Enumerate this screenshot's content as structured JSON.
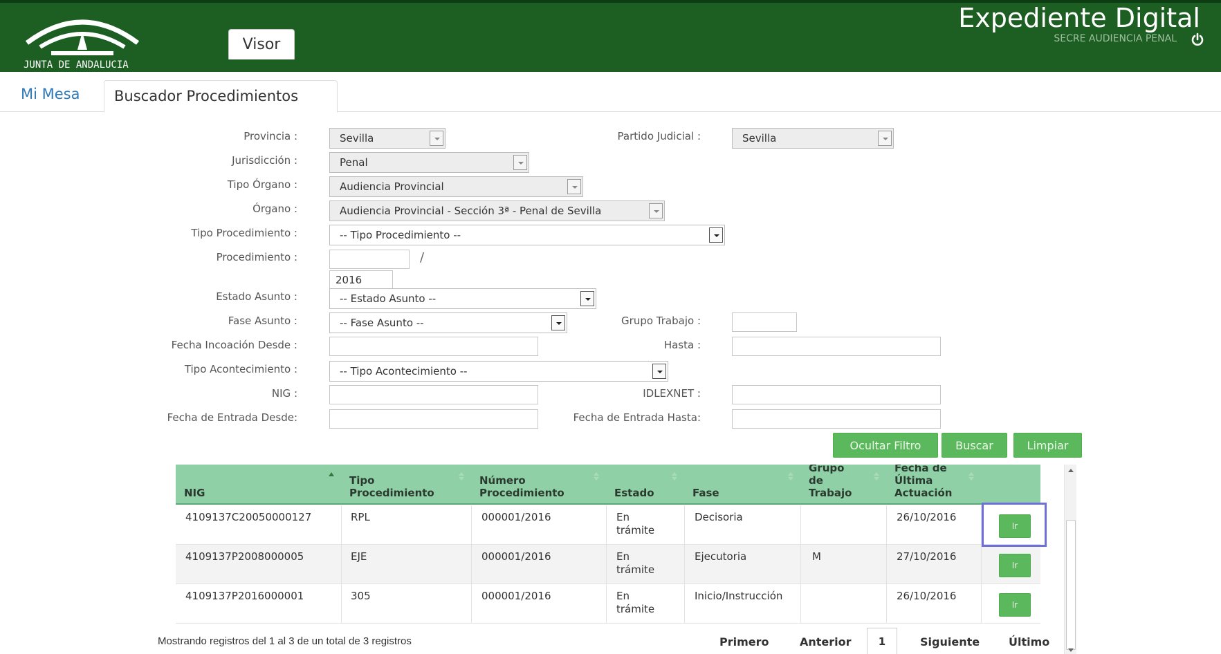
{
  "header": {
    "logo_text": "JUNTA DE ANDALUCIA",
    "visor_tab": "Visor",
    "app_title": "Expediente Digital",
    "user": "SECRE AUDIENCIA PENAL",
    "logout_icon": "power-icon"
  },
  "nav": {
    "mi_mesa": "Mi Mesa",
    "buscador": "Buscador Procedimientos"
  },
  "form": {
    "provincia": {
      "label": "Provincia :",
      "value": "Sevilla"
    },
    "partido_judicial": {
      "label": "Partido Judicial :",
      "value": "Sevilla"
    },
    "jurisdiccion": {
      "label": "Jurisdicción :",
      "value": "Penal"
    },
    "tipo_organo": {
      "label": "Tipo Órgano :",
      "value": "Audiencia Provincial"
    },
    "organo": {
      "label": "Órgano :",
      "value": "Audiencia Provincial - Sección 3ª - Penal de Sevilla"
    },
    "tipo_procedimiento": {
      "label": "Tipo Procedimiento :",
      "value": "-- Tipo Procedimiento --"
    },
    "procedimiento": {
      "label": "Procedimiento :",
      "number": "",
      "year": "2016",
      "separator": "/"
    },
    "estado_asunto": {
      "label": "Estado Asunto :",
      "value": "-- Estado Asunto --"
    },
    "fase_asunto": {
      "label": "Fase Asunto :",
      "value": "-- Fase Asunto --"
    },
    "grupo_trabajo": {
      "label": "Grupo Trabajo :",
      "value": ""
    },
    "fecha_incoacion_desde": {
      "label": "Fecha Incoación Desde :",
      "value": ""
    },
    "hasta": {
      "label": "Hasta :",
      "value": ""
    },
    "tipo_acontecimiento": {
      "label": "Tipo Acontecimiento :",
      "value": "-- Tipo Acontecimiento --"
    },
    "nig": {
      "label": "NIG :",
      "value": ""
    },
    "idlexnet": {
      "label": "IDLEXNET :",
      "value": ""
    },
    "fecha_entrada_desde": {
      "label": "Fecha de Entrada Desde:",
      "value": ""
    },
    "fecha_entrada_hasta": {
      "label": "Fecha de Entrada Hasta:",
      "value": ""
    }
  },
  "buttons": {
    "ocultar": "Ocultar Filtro",
    "buscar": "Buscar",
    "limpiar": "Limpiar",
    "color": "#5cb85c"
  },
  "table": {
    "columns": [
      {
        "line1": "",
        "line2": "NIG"
      },
      {
        "line1": "Tipo",
        "line2": "Procedimiento"
      },
      {
        "line1": "Número",
        "line2": "Procedimiento"
      },
      {
        "line1": "",
        "line2": "Estado"
      },
      {
        "line1": "",
        "line2": "Fase"
      },
      {
        "line1": "Grupo",
        "line2": "de",
        "line3": "Trabajo"
      },
      {
        "line1": "Fecha de",
        "line2": "Última",
        "line3": "Actuación"
      }
    ],
    "rows": [
      {
        "nig": "4109137C20050000127",
        "tipo": "RPL",
        "numero": "000001/2016",
        "estado1": "En",
        "estado2": "trámite",
        "fase": "Decisoria",
        "grupo": "",
        "fecha": "26/10/2016",
        "accion": "Ir"
      },
      {
        "nig": "4109137P2008000005",
        "tipo": "EJE",
        "numero": "000001/2016",
        "estado1": "En",
        "estado2": "trámite",
        "fase": "Ejecutoria",
        "grupo": "M",
        "fecha": "27/10/2016",
        "accion": "Ir"
      },
      {
        "nig": "4109137P2016000001",
        "tipo": "305",
        "numero": "000001/2016",
        "estado1": "En",
        "estado2": "trámite",
        "fase": "Inicio/Instrucción",
        "grupo": "",
        "fecha": "26/10/2016",
        "accion": "Ir"
      }
    ]
  },
  "footer": {
    "info": "Mostrando registros del 1 al 3 de un total de 3 registros",
    "primero": "Primero",
    "anterior": "Anterior",
    "current_page": "1",
    "siguiente": "Siguiente",
    "ultimo": "Último"
  }
}
